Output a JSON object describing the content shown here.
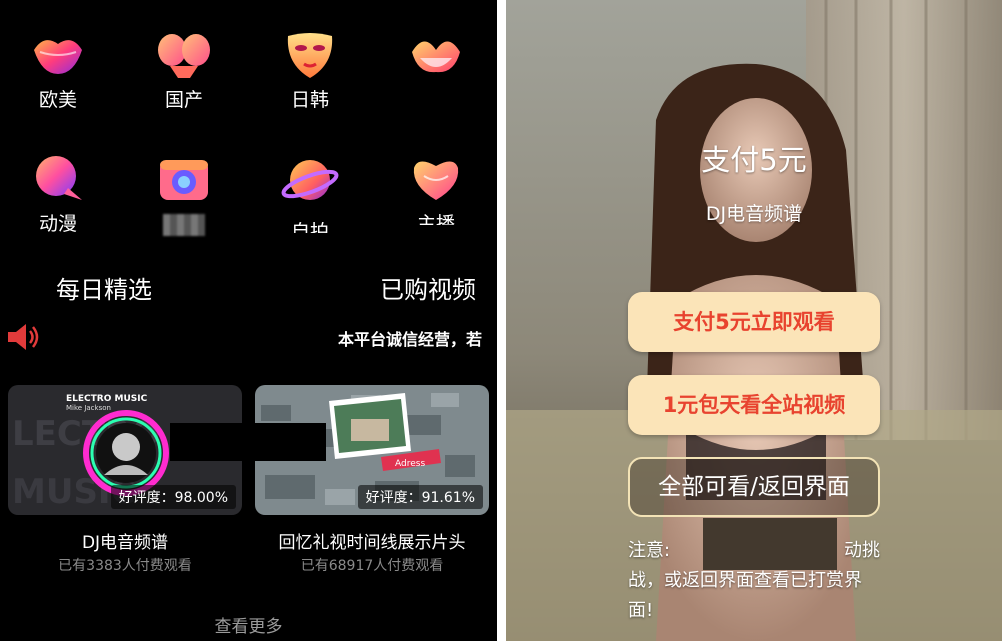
{
  "left": {
    "categories": [
      {
        "label": "欧美",
        "icon": "lips-icon"
      },
      {
        "label": "国产",
        "icon": "bikini-icon"
      },
      {
        "label": "日韩",
        "icon": "mask-icon"
      },
      {
        "label": "",
        "icon": "bra-icon"
      },
      {
        "label": "动漫",
        "icon": "chat-bubble-icon"
      },
      {
        "label": "",
        "icon": "camera-icon"
      },
      {
        "label": "自拍",
        "icon": "planet-icon"
      },
      {
        "label": "主播",
        "icon": "heart-lips-icon"
      }
    ],
    "daily_pick": "每日精选",
    "purchased": "已购视频",
    "marquee": "本平台诚信经营，若",
    "videos": [
      {
        "title": "DJ电音频谱",
        "rating": "好评度：98.00%",
        "paid": "已有3383人付费观看",
        "thumb_text_1": "ELECTRO MUSIC",
        "thumb_text_2": "Mike Jackson"
      },
      {
        "title": "回忆礼视时间线展示片头",
        "rating": "好评度：91.61%",
        "paid": "已有68917人付费观看",
        "thumb_text_1": "Adress"
      }
    ],
    "see_more": "查看更多"
  },
  "right": {
    "pay_title": "支付5元",
    "pay_sub": "DJ电音频谱",
    "btn_pay": "支付5元立即观看",
    "btn_day": "1元包天看全站视频",
    "btn_back": "全部可看/返回界面",
    "note_prefix": "注意:",
    "note_suffix": "动挑",
    "note_line2": "战，或返回界面查看已打赏界面!"
  },
  "colors": {
    "accent_red": "#e8432f",
    "button_gold": "#fbe4b8",
    "outline_gold": "#f3e3b6"
  }
}
